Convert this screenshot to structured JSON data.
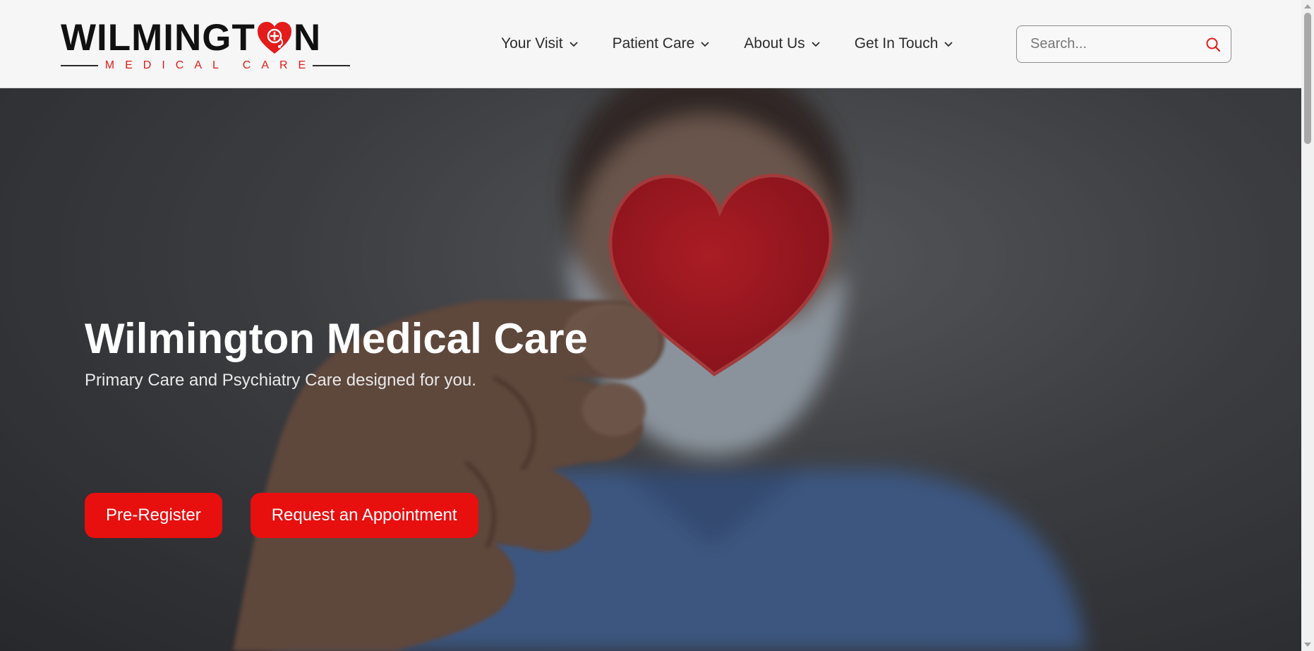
{
  "brand": {
    "name_left": "WILMINGT",
    "name_right": "N",
    "tagline": "MEDICAL CARE",
    "accent_color": "#e31b1b",
    "heart_icon": "heart-stethoscope-icon"
  },
  "nav": {
    "items": [
      {
        "label": "Your Visit",
        "icon": "chevron-down-icon"
      },
      {
        "label": "Patient Care",
        "icon": "chevron-down-icon"
      },
      {
        "label": "About Us",
        "icon": "chevron-down-icon"
      },
      {
        "label": "Get In Touch",
        "icon": "chevron-down-icon"
      }
    ]
  },
  "search": {
    "placeholder": "Search...",
    "value": "",
    "icon": "search-icon"
  },
  "hero": {
    "title": "Wilmington Medical Care",
    "subtitle": "Primary Care and Psychiatry Care designed for you.",
    "primary_button": "Pre-Register",
    "secondary_button": "Request an Appointment",
    "button_color": "#e80f0f"
  }
}
